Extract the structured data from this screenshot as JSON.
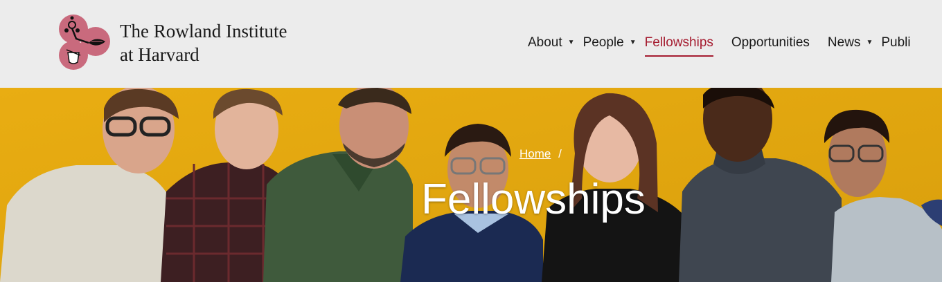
{
  "header": {
    "logo_line1": "The Rowland Institute",
    "logo_line2": "at Harvard"
  },
  "nav": {
    "items": [
      {
        "label": "About",
        "dropdown": true,
        "active": false
      },
      {
        "label": "People",
        "dropdown": true,
        "active": false
      },
      {
        "label": "Fellowships",
        "dropdown": false,
        "active": true
      },
      {
        "label": "Opportunities",
        "dropdown": false,
        "active": false
      },
      {
        "label": "News",
        "dropdown": true,
        "active": false
      },
      {
        "label": "Publi",
        "dropdown": false,
        "active": false
      }
    ],
    "caret": "▼"
  },
  "hero": {
    "breadcrumb_home": "Home",
    "breadcrumb_sep": "/",
    "title": "Fellowships"
  },
  "colors": {
    "accent": "#a51c30",
    "logo_circle": "#c96a7d",
    "hero_bg": "#e3a80a",
    "header_bg": "#ececec"
  }
}
